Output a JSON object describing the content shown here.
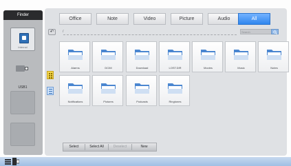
{
  "sidebar": {
    "title": "Finder",
    "drives": [
      {
        "label": "Internal",
        "icon": "internal-storage-icon"
      },
      {
        "label": "USB1",
        "icon": "usb-drive-icon"
      },
      {
        "label": "",
        "icon": ""
      },
      {
        "label": "",
        "icon": ""
      }
    ]
  },
  "tabs": [
    {
      "label": "Office",
      "active": false
    },
    {
      "label": "Note",
      "active": false
    },
    {
      "label": "Video",
      "active": false
    },
    {
      "label": "Picture",
      "active": false
    },
    {
      "label": "Audio",
      "active": false
    },
    {
      "label": "All",
      "active": true
    }
  ],
  "path": {
    "text": "/",
    "back_icon": "back-arrow-icon"
  },
  "search": {
    "placeholder": "Search",
    "icon": "search-icon"
  },
  "view_tools": [
    "grid-view-icon",
    "list-view-icon"
  ],
  "folders": [
    {
      "name": "Alarms"
    },
    {
      "name": "DCIM"
    },
    {
      "name": "Download"
    },
    {
      "name": "LOST.DIR"
    },
    {
      "name": "Movies"
    },
    {
      "name": "Music"
    },
    {
      "name": "Notes"
    },
    {
      "name": "Notifications"
    },
    {
      "name": "Pictures"
    },
    {
      "name": "Podcasts"
    },
    {
      "name": "Ringtones"
    }
  ],
  "toolbar": {
    "select": "Select",
    "select_all": "Select All",
    "deselect": "Deselect",
    "new": "New"
  },
  "colors": {
    "active_tab": "#3b8cf0",
    "sidebar_header": "#2a2b2d",
    "folder_blue": "#4a86d0"
  }
}
